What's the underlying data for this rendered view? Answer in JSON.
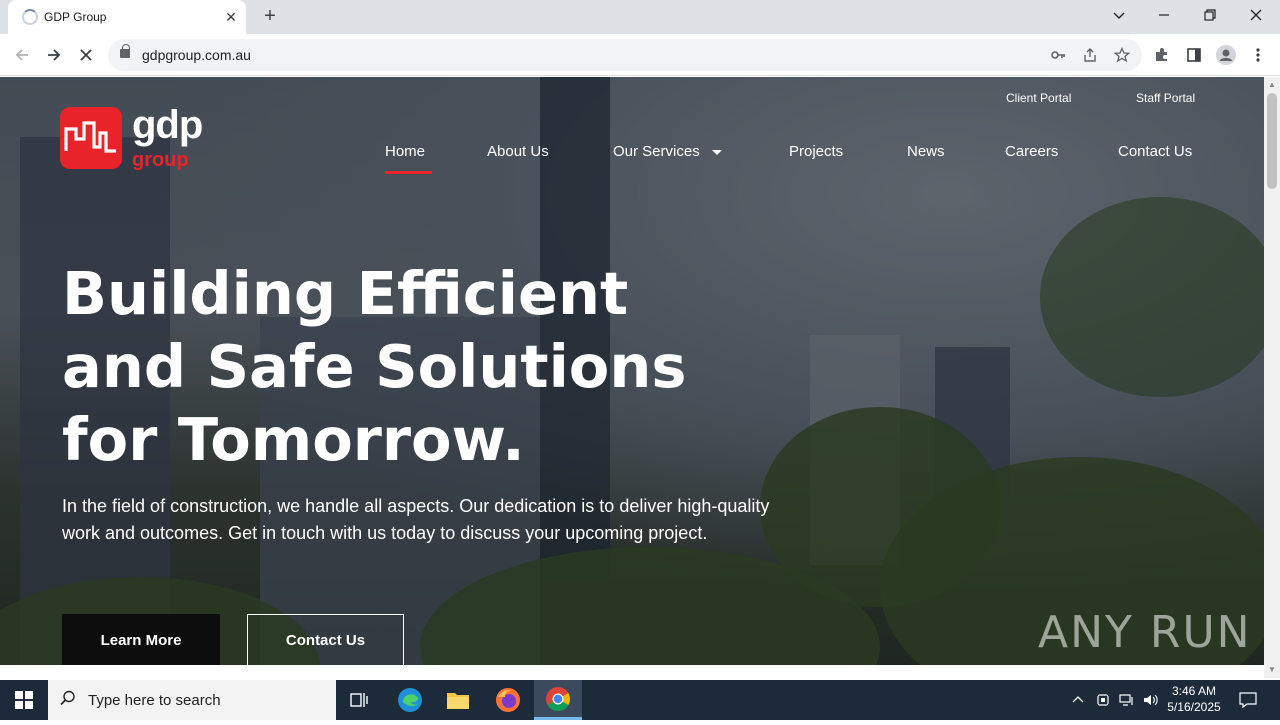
{
  "browser": {
    "tab_title": "GDP Group",
    "url": "gdpgroup.com.au",
    "new_tab_symbol": "+",
    "tab_close_symbol": "✕"
  },
  "site": {
    "logo": {
      "gdp": "gdp",
      "group": "group"
    },
    "utility_links": [
      "Client Portal",
      "Staff Portal"
    ],
    "nav": {
      "home": "Home",
      "about": "About Us",
      "services": "Our Services",
      "projects": "Projects",
      "news": "News",
      "careers": "Careers",
      "contact": "Contact Us"
    },
    "hero": {
      "headline_line1": "Building Efficient",
      "headline_line2": "and Safe Solutions",
      "headline_line3": "for Tomorrow.",
      "subtext": "In the field of construction, we handle all aspects. Our dedication is to deliver high-quality work and outcomes. Get in touch with us today to discuss your upcoming project.",
      "button_primary": "Learn More",
      "button_secondary": "Contact Us"
    },
    "watermark": "ANY RUN"
  },
  "taskbar": {
    "search_placeholder": "Type here to search",
    "time": "3:46 AM",
    "date": "5/16/2025"
  },
  "colors": {
    "brand_red": "#e8232a",
    "taskbar": "#1c2a3a"
  }
}
